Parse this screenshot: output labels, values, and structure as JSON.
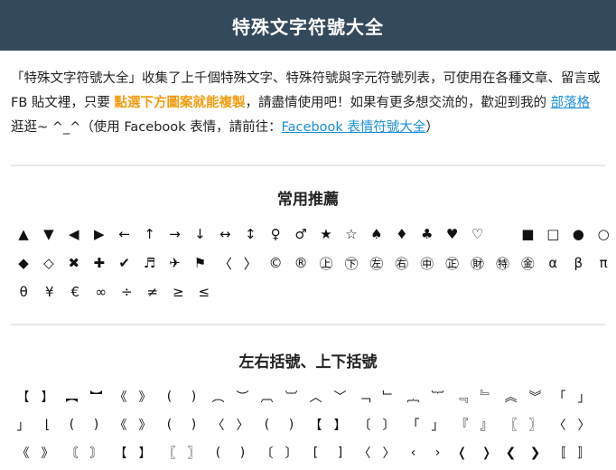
{
  "header": {
    "title": "特殊文字符號大全"
  },
  "intro": {
    "text1": "「特殊文字符號大全」收集了上千個特殊文字、特殊符號與字元符號列表，可使用在各種文章、留言或 FB 貼文裡，只要 ",
    "highlight": "點選下方圖案就能複製",
    "text2": "，請盡情使用吧！如果有更多想交流的，歡迎到我的 ",
    "link1": "部落格",
    "text3": " 逛逛~ ^_^（使用 Facebook 表情，請前往：",
    "link2": "Facebook 表情符號大全",
    "text4": "）"
  },
  "sections": {
    "common": {
      "title": "常用推薦",
      "rows": [
        [
          "▲",
          "▼",
          "◀",
          "▶",
          "←",
          "↑",
          "→",
          "↓",
          "↔",
          "↕",
          "♀",
          "♂",
          "★",
          "☆",
          "♠",
          "♦",
          "♣",
          "♥",
          "♡",
          "",
          "■",
          "□",
          "●",
          "○"
        ],
        [
          "◆",
          "◇",
          "✖",
          "✚",
          "✔",
          "♬",
          "✈",
          "⚑",
          "〈",
          "〉",
          "©",
          "®",
          "㊤",
          "㊦",
          "㊧",
          "㊨",
          "㊥",
          "㊣",
          "㊖",
          "㊕",
          "㊎",
          "α",
          "β",
          "π"
        ],
        [
          "θ",
          "¥",
          "€",
          "∞",
          "÷",
          "≠",
          "≥",
          "≤"
        ]
      ]
    },
    "brackets": {
      "title": "左右括號、上下括號",
      "rows": [
        [
          "【",
          "】",
          "︻",
          "︼",
          "《",
          "》",
          "(",
          ")",
          "︵",
          "︶",
          "︹",
          "︺",
          "︿",
          "﹀",
          "﹁",
          "﹂",
          "︷",
          "︸",
          "﹃",
          "﹄",
          "︽",
          "︾",
          "「",
          "」"
        ],
        [
          "」",
          "⌊",
          "(",
          ")",
          "《",
          "》",
          "(",
          ")",
          "〈",
          "〉",
          "(",
          ")",
          "【",
          "】",
          "〔",
          "〕",
          "「",
          "」",
          "『",
          "』",
          "〖",
          "〗",
          "〈",
          "〉"
        ],
        [
          "《",
          "》",
          "〘",
          "〙",
          "【",
          "】",
          "〖",
          "〗",
          "(",
          ")",
          "〔",
          "〕",
          "[",
          "]",
          "〈",
          "〉",
          "‹",
          "›",
          "❬",
          "❭",
          "❮",
          "❯",
          "〚",
          "〛"
        ]
      ]
    }
  }
}
